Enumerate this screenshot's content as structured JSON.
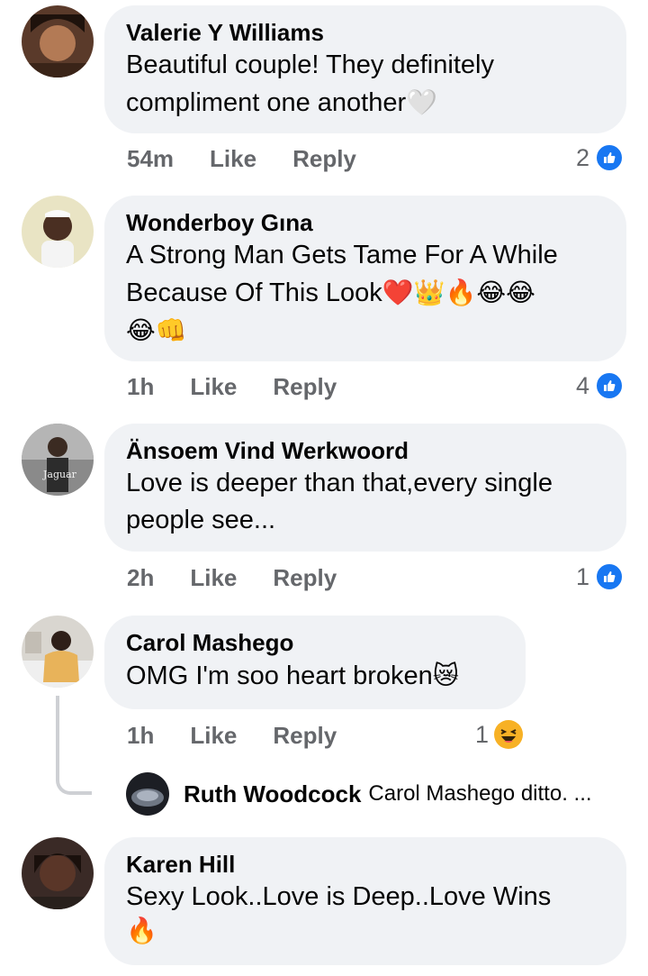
{
  "comments": [
    {
      "name": "Valerie Y Williams",
      "text": " Beautiful couple!  They definitely compliment one another",
      "emoji": "🤍",
      "time": "54m",
      "like": "Like",
      "reply": "Reply",
      "reaction_count": "2",
      "reaction": "like"
    },
    {
      "name": "Wonderboy Gına",
      "text_line1": "A Strong Man Gets Tame For A While",
      "text_line2": "Because Of This Look",
      "emoji_line2": "❤️👑🔥😂😂",
      "emoji_line3": "😂👊",
      "time": "1h",
      "like": "Like",
      "reply": "Reply",
      "reaction_count": "4",
      "reaction": "like"
    },
    {
      "name": "Änsoem Vind Werkwoord",
      "text": "Love is deeper than that,every single people see...",
      "avatar_caption": "Jaguar",
      "time": "2h",
      "like": "Like",
      "reply": "Reply",
      "reaction_count": "1",
      "reaction": "like"
    },
    {
      "name": "Carol Mashego",
      "text": "OMG I'm soo heart broken",
      "emoji": "😿",
      "time": "1h",
      "like": "Like",
      "reply": "Reply",
      "reaction_count": "1",
      "reaction": "haha"
    },
    {
      "name": "Karen Hill",
      "text": "Sexy Look..Love is Deep..Love Wins",
      "emoji": "🔥"
    }
  ],
  "reply_preview": {
    "name": "Ruth Woodcock",
    "text": "Carol Mashego ditto. ..."
  },
  "colors": {
    "bubble": "#f0f2f5",
    "meta": "#65676b",
    "like_blue": "#1877f2",
    "thread_line": "#ced0d4"
  }
}
